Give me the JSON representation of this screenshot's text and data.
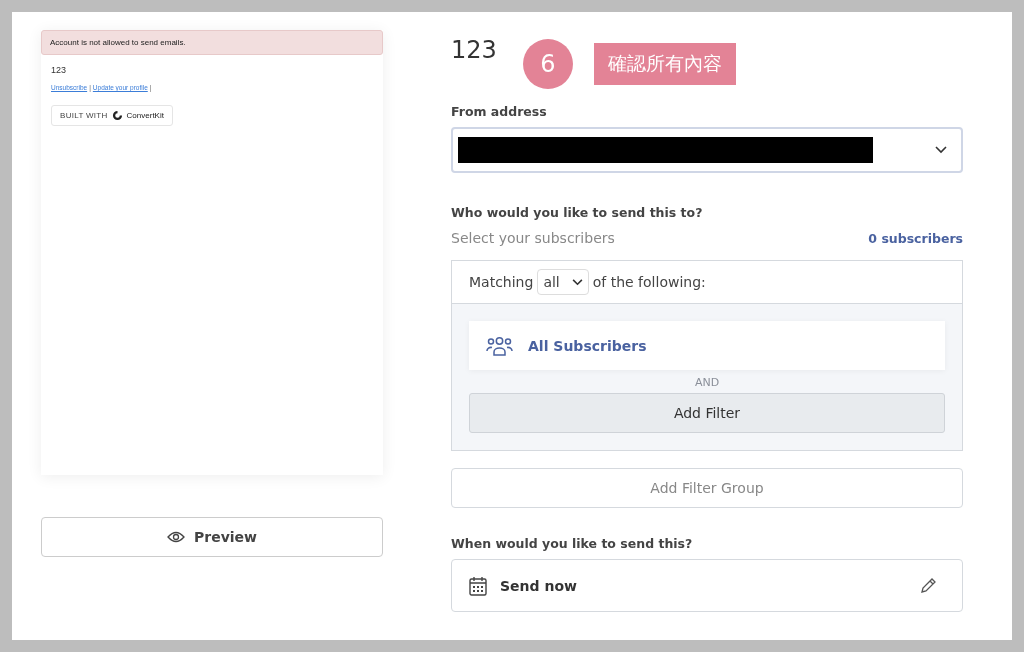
{
  "email_preview": {
    "alert": "Account is not allowed to send emails.",
    "body": "123",
    "links": [
      {
        "label": "Unsubscribe"
      },
      {
        "label": "Update your profile"
      }
    ],
    "separator": "|",
    "badge": {
      "prefix": "BUILT WITH",
      "brand": "ConvertKit"
    }
  },
  "preview_button": {
    "label": "Preview"
  },
  "title": "123",
  "step_badge": "6",
  "step_label": "確認所有內容",
  "from_address": {
    "label": "From address",
    "redacted": true
  },
  "recipients": {
    "question": "Who would you like to send this to?",
    "hint": "Select your subscribers",
    "count": "0 subscribers",
    "matching_prefix": "Matching",
    "matching_value": "all",
    "matching_suffix": "of the following:",
    "filters": [
      {
        "label": "All Subscribers"
      }
    ],
    "joiner": "AND",
    "add_filter": "Add Filter",
    "add_filter_group": "Add Filter Group"
  },
  "schedule": {
    "question": "When would you like to send this?",
    "value": "Send now"
  }
}
